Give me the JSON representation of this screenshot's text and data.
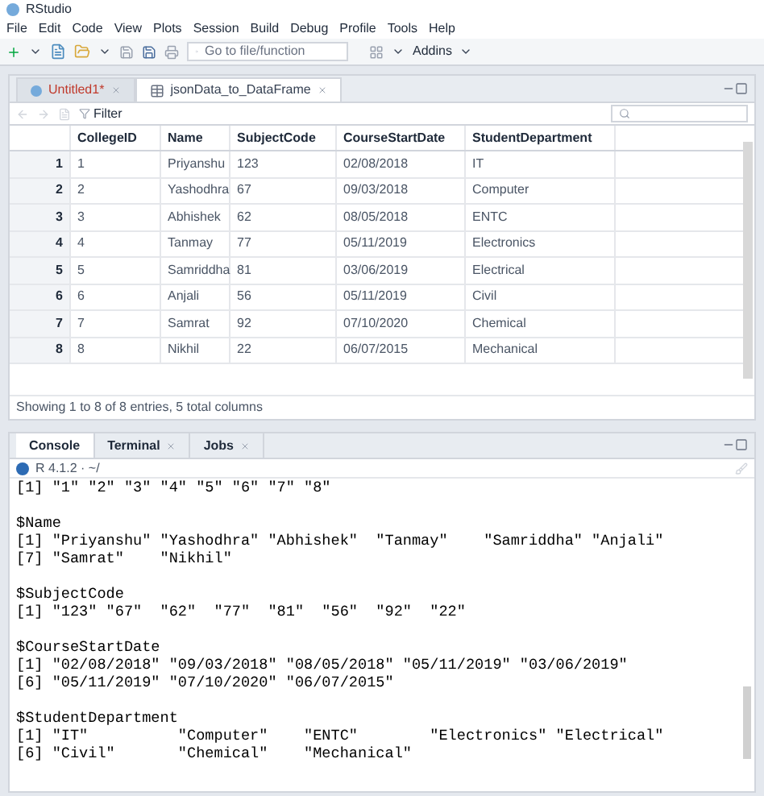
{
  "window": {
    "title": "RStudio"
  },
  "menu": [
    "File",
    "Edit",
    "Code",
    "View",
    "Plots",
    "Session",
    "Build",
    "Debug",
    "Profile",
    "Tools",
    "Help"
  ],
  "toolbar": {
    "goto_placeholder": "Go to file/function",
    "addins": "Addins"
  },
  "editor_tabs": [
    {
      "label": "Untitled1*",
      "selected": false,
      "kind": "script"
    },
    {
      "label": "jsonData_to_DataFrame",
      "selected": true,
      "kind": "data"
    }
  ],
  "viewer": {
    "filter": "Filter"
  },
  "table": {
    "columns": [
      "CollegeID",
      "Name",
      "SubjectCode",
      "CourseStartDate",
      "StudentDepartment"
    ],
    "rows": [
      {
        "row": "1",
        "cells": [
          "1",
          "Priyanshu",
          "123",
          "02/08/2018",
          "IT"
        ]
      },
      {
        "row": "2",
        "cells": [
          "2",
          "Yashodhra",
          "67",
          "09/03/2018",
          "Computer"
        ]
      },
      {
        "row": "3",
        "cells": [
          "3",
          "Abhishek",
          "62",
          "08/05/2018",
          "ENTC"
        ]
      },
      {
        "row": "4",
        "cells": [
          "4",
          "Tanmay",
          "77",
          "05/11/2019",
          "Electronics"
        ]
      },
      {
        "row": "5",
        "cells": [
          "5",
          "Samriddha",
          "81",
          "03/06/2019",
          "Electrical"
        ]
      },
      {
        "row": "6",
        "cells": [
          "6",
          "Anjali",
          "56",
          "05/11/2019",
          "Civil"
        ]
      },
      {
        "row": "7",
        "cells": [
          "7",
          "Samrat",
          "92",
          "07/10/2020",
          "Chemical"
        ]
      },
      {
        "row": "8",
        "cells": [
          "8",
          "Nikhil",
          "22",
          "06/07/2015",
          "Mechanical"
        ]
      }
    ]
  },
  "status_bar": "Showing 1 to 8 of 8 entries, 5 total columns",
  "console_tabs": [
    {
      "label": "Console",
      "selected": true,
      "closable": false
    },
    {
      "label": "Terminal",
      "selected": false,
      "closable": true
    },
    {
      "label": "Jobs",
      "selected": false,
      "closable": true
    }
  ],
  "console_path": "R 4.1.2 · ~/",
  "console_blocks": [
    {
      "lines": [
        "[1] \"1\" \"2\" \"3\" \"4\" \"5\" \"6\" \"7\" \"8\""
      ]
    },
    {
      "lines": [
        "$Name",
        "[1] \"Priyanshu\" \"Yashodhra\" \"Abhishek\"  \"Tanmay\"    \"Samriddha\" \"Anjali\"",
        "[7] \"Samrat\"    \"Nikhil\""
      ]
    },
    {
      "lines": [
        "$SubjectCode",
        "[1] \"123\" \"67\"  \"62\"  \"77\"  \"81\"  \"56\"  \"92\"  \"22\""
      ]
    },
    {
      "lines": [
        "$CourseStartDate",
        "[1] \"02/08/2018\" \"09/03/2018\" \"08/05/2018\" \"05/11/2019\" \"03/06/2019\"",
        "[6] \"05/11/2019\" \"07/10/2020\" \"06/07/2015\""
      ]
    },
    {
      "lines": [
        "$StudentDepartment",
        "[1] \"IT\"          \"Computer\"    \"ENTC\"        \"Electronics\" \"Electrical\"",
        "[6] \"Civil\"       \"Chemical\"    \"Mechanical\""
      ]
    }
  ]
}
